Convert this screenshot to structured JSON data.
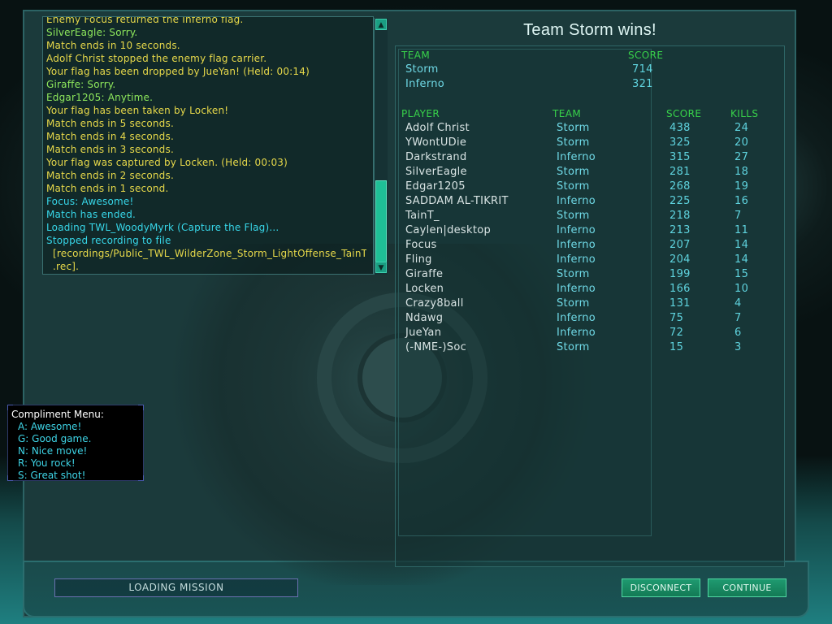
{
  "chat": {
    "lines": [
      {
        "text": "Enemy Focus returned the Inferno flag.",
        "color": "y"
      },
      {
        "text": "SilverEagle: Sorry.",
        "color": "g"
      },
      {
        "text": "Match ends in 10 seconds.",
        "color": "y"
      },
      {
        "text": "Adolf Christ stopped the enemy flag carrier.",
        "color": "y"
      },
      {
        "text": "Your flag has been dropped by JueYan! (Held: 00:14)",
        "color": "y"
      },
      {
        "text": "Giraffe: Sorry.",
        "color": "g"
      },
      {
        "text": "Edgar1205: Anytime.",
        "color": "g"
      },
      {
        "text": "Your flag has been taken by Locken!",
        "color": "y"
      },
      {
        "text": "Match ends in 5 seconds.",
        "color": "y"
      },
      {
        "text": "Match ends in 4 seconds.",
        "color": "y"
      },
      {
        "text": "Match ends in 3 seconds.",
        "color": "y"
      },
      {
        "text": "Your flag was captured by Locken. (Held: 00:03)",
        "color": "y"
      },
      {
        "text": "Match ends in 2 seconds.",
        "color": "y"
      },
      {
        "text": "Match ends in 1 second.",
        "color": "y"
      },
      {
        "text": "Focus: Awesome!",
        "color": "c"
      },
      {
        "text": "Match has ended.",
        "color": "c"
      },
      {
        "text": "Loading TWL_WoodyMyrk (Capture the Flag)...",
        "color": "c"
      },
      {
        "text": "Stopped recording to file",
        "color": "c"
      },
      {
        "text": "  [recordings/Public_TWL_WilderZone_Storm_LightOffense_TainT_",
        "color": "y"
      },
      {
        "text": "  .rec].",
        "color": "y"
      }
    ]
  },
  "compliment_menu": {
    "title": "Compliment Menu:",
    "items": [
      "A: Awesome!",
      "G: Good game.",
      "N: Nice move!",
      "R: You rock!",
      "S: Great shot!"
    ]
  },
  "scoreboard": {
    "title": "Team Storm wins!",
    "team_headers": {
      "team": "TEAM",
      "score": "SCORE"
    },
    "teams": [
      {
        "name": "Storm",
        "score": "714"
      },
      {
        "name": "Inferno",
        "score": "321"
      }
    ],
    "player_headers": {
      "player": "PLAYER",
      "team": "TEAM",
      "score": "SCORE",
      "kills": "KILLS"
    },
    "players": [
      {
        "name": "Adolf Christ",
        "team": "Storm",
        "score": "438",
        "kills": "24"
      },
      {
        "name": "YWontUDie",
        "team": "Storm",
        "score": "325",
        "kills": "20"
      },
      {
        "name": "Darkstrand",
        "team": "Inferno",
        "score": "315",
        "kills": "27"
      },
      {
        "name": "SilverEagle",
        "team": "Storm",
        "score": "281",
        "kills": "18"
      },
      {
        "name": "Edgar1205",
        "team": "Storm",
        "score": "268",
        "kills": "19"
      },
      {
        "name": "SADDAM AL-TIKRIT",
        "team": "Inferno",
        "score": "225",
        "kills": "16"
      },
      {
        "name": "TainT_",
        "team": "Storm",
        "score": "218",
        "kills": "7"
      },
      {
        "name": "Caylen|desktop",
        "team": "Inferno",
        "score": "213",
        "kills": "11"
      },
      {
        "name": "Focus",
        "team": "Inferno",
        "score": "207",
        "kills": "14"
      },
      {
        "name": "Fling",
        "team": "Inferno",
        "score": "204",
        "kills": "14"
      },
      {
        "name": "Giraffe",
        "team": "Storm",
        "score": "199",
        "kills": "15"
      },
      {
        "name": "Locken",
        "team": "Inferno",
        "score": "166",
        "kills": "10"
      },
      {
        "name": "Crazy8ball",
        "team": "Storm",
        "score": "131",
        "kills": "4"
      },
      {
        "name": "Ndawg",
        "team": "Inferno",
        "score": "75",
        "kills": "7"
      },
      {
        "name": "JueYan",
        "team": "Inferno",
        "score": "72",
        "kills": "6"
      },
      {
        "name": "(-NME-)Soc",
        "team": "Storm",
        "score": "15",
        "kills": "3"
      }
    ]
  },
  "footer": {
    "loading_label": "LOADING MISSION",
    "disconnect_label": "DISCONNECT",
    "continue_label": "CONTINUE"
  },
  "colors": {
    "chat_yellow": "#e6d84a",
    "chat_green": "#8ee85c",
    "chat_cyan": "#37d6e8",
    "header_green": "#38d24a",
    "button_green": "#1f9a70"
  }
}
